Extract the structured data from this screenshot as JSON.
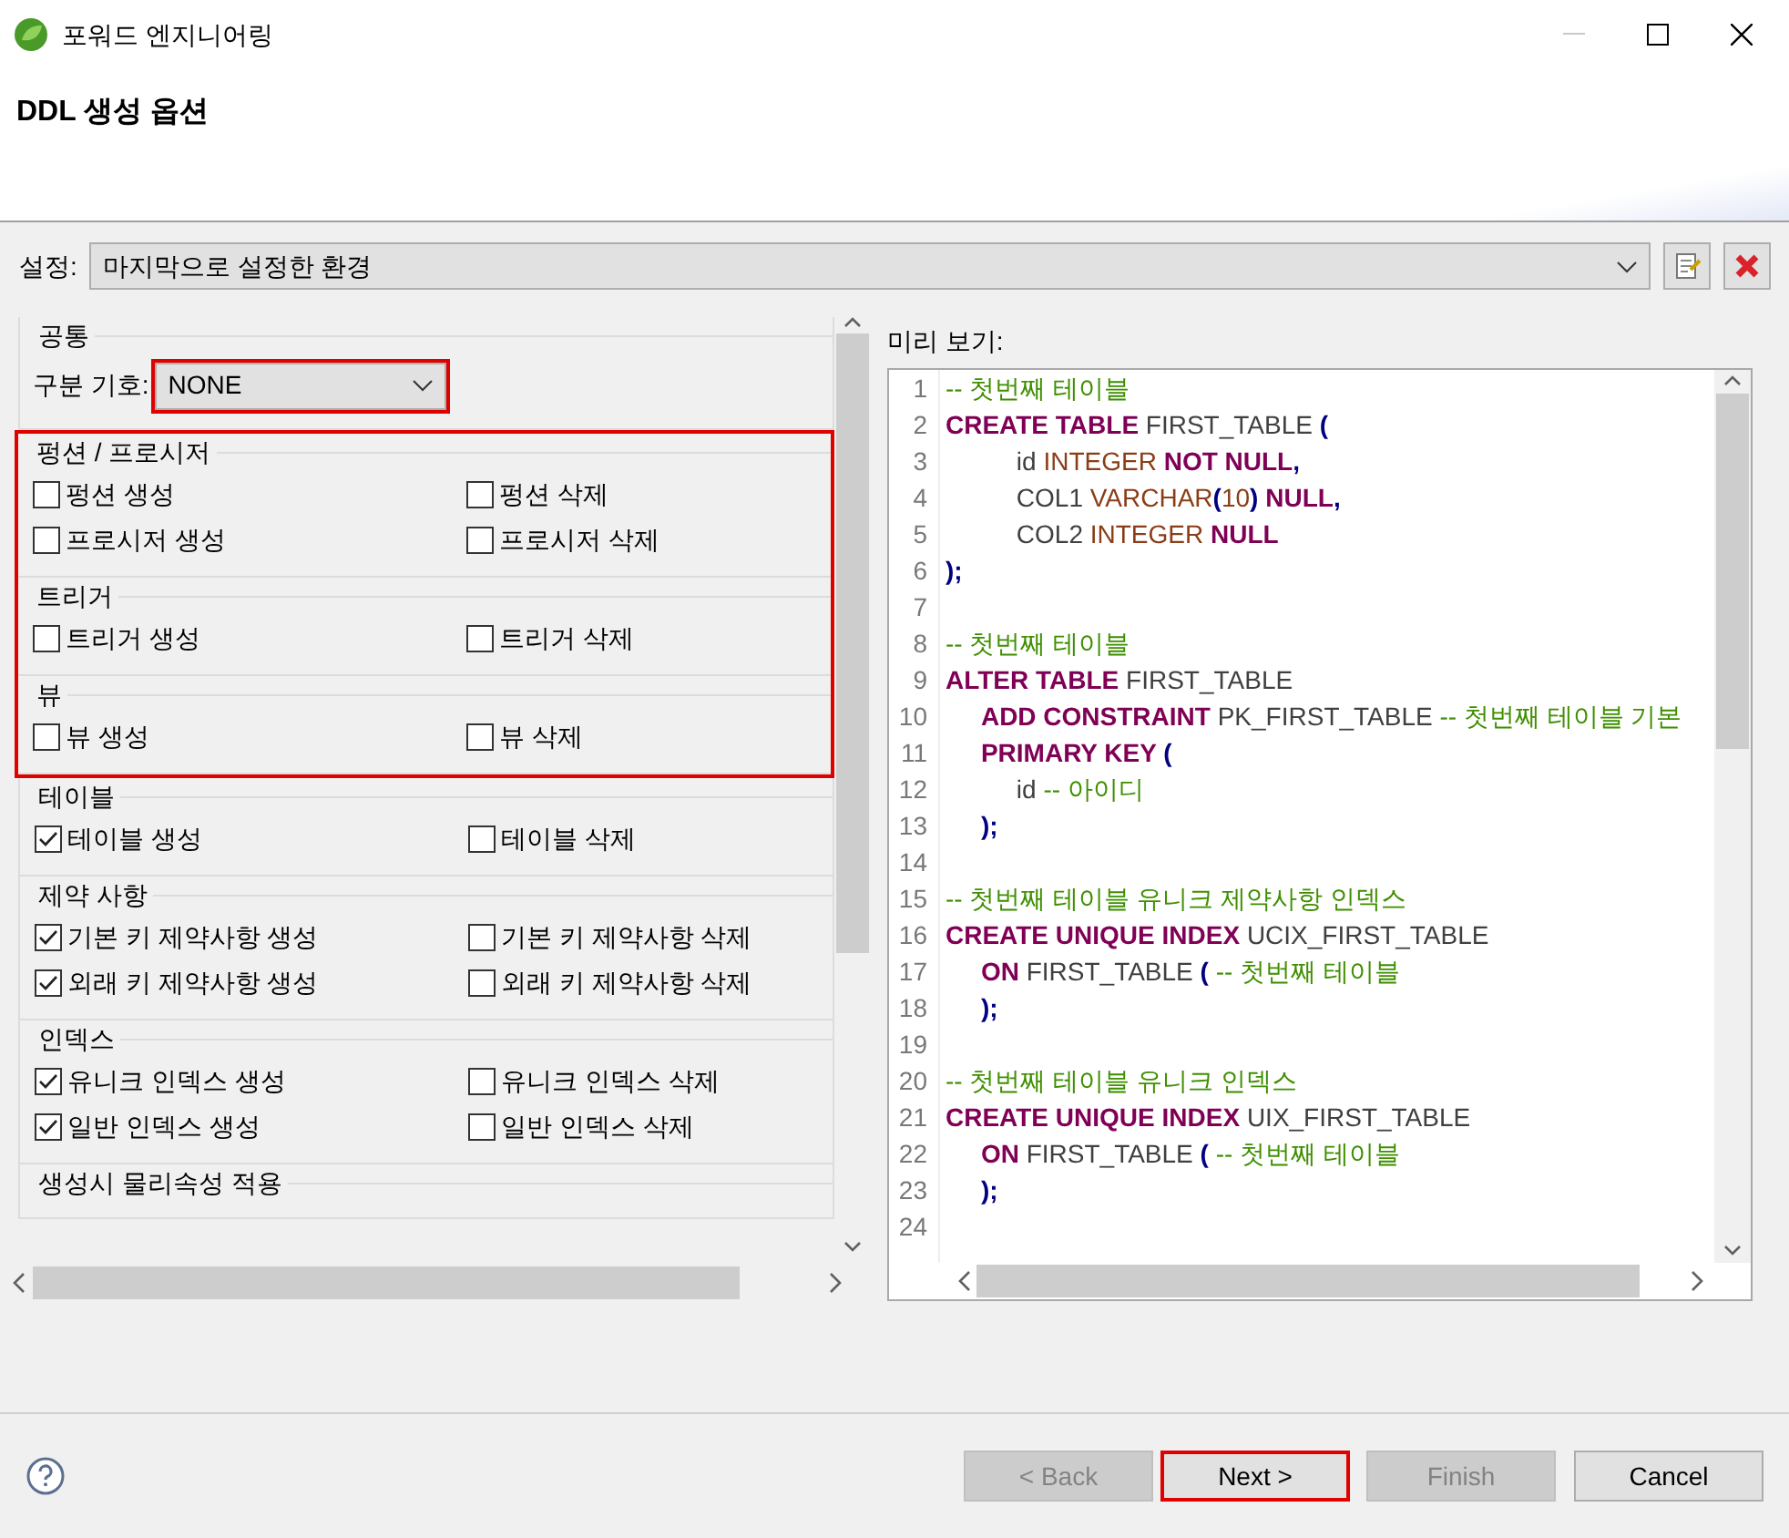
{
  "window": {
    "title": "포워드 엔지니어링"
  },
  "header": {
    "title": "DDL 생성 옵션"
  },
  "settings": {
    "label": "설정:",
    "value": "마지막으로 설정한 환경"
  },
  "options_panel": {
    "groups": [
      {
        "title": "공통",
        "highlighted": false,
        "separator": {
          "label": "구분 기호:",
          "value": "NONE",
          "highlighted": true
        }
      },
      {
        "title": "펑션 / 프로시저",
        "highlighted": true,
        "options": [
          {
            "label": "펑션 생성",
            "checked": false
          },
          {
            "label": "펑션 삭제",
            "checked": false
          },
          {
            "label": "프로시저 생성",
            "checked": false
          },
          {
            "label": "프로시저 삭제",
            "checked": false
          }
        ]
      },
      {
        "title": "트리거",
        "highlighted": true,
        "options": [
          {
            "label": "트리거 생성",
            "checked": false
          },
          {
            "label": "트리거 삭제",
            "checked": false
          }
        ]
      },
      {
        "title": "뷰",
        "highlighted": true,
        "options": [
          {
            "label": "뷰 생성",
            "checked": false
          },
          {
            "label": "뷰 삭제",
            "checked": false
          }
        ]
      },
      {
        "title": "테이블",
        "highlighted": false,
        "options": [
          {
            "label": "테이블 생성",
            "checked": true
          },
          {
            "label": "테이블 삭제",
            "checked": false
          }
        ]
      },
      {
        "title": "제약 사항",
        "highlighted": false,
        "options": [
          {
            "label": "기본 키 제약사항 생성",
            "checked": true
          },
          {
            "label": "기본 키 제약사항 삭제",
            "checked": false
          },
          {
            "label": "외래 키 제약사항 생성",
            "checked": true
          },
          {
            "label": "외래 키 제약사항 삭제",
            "checked": false
          }
        ]
      },
      {
        "title": "인덱스",
        "highlighted": false,
        "options": [
          {
            "label": "유니크 인덱스 생성",
            "checked": true
          },
          {
            "label": "유니크 인덱스 삭제",
            "checked": false
          },
          {
            "label": "일반 인덱스 생성",
            "checked": true
          },
          {
            "label": "일반 인덱스 삭제",
            "checked": false
          }
        ]
      },
      {
        "title": "생성시 물리속성 적용",
        "highlighted": false
      }
    ]
  },
  "preview": {
    "label": "미리 보기:",
    "lines": [
      {
        "number": "1",
        "tokens": [
          {
            "kind": "comment",
            "text": "-- 첫번째 테이블"
          }
        ]
      },
      {
        "number": "2",
        "tokens": [
          {
            "kind": "keyword",
            "text": "CREATE TABLE "
          },
          {
            "kind": "name",
            "text": "FIRST_TABLE "
          },
          {
            "kind": "punct",
            "text": "("
          }
        ]
      },
      {
        "number": "3",
        "tokens": [
          {
            "kind": "name",
            "text": "\t\tid "
          },
          {
            "kind": "type",
            "text": "INTEGER "
          },
          {
            "kind": "keyword",
            "text": "NOT NULL"
          },
          {
            "kind": "punct",
            "text": ","
          }
        ]
      },
      {
        "number": "4",
        "tokens": [
          {
            "kind": "name",
            "text": "\t\tCOL1 "
          },
          {
            "kind": "type",
            "text": "VARCHAR"
          },
          {
            "kind": "punct",
            "text": "("
          },
          {
            "kind": "type",
            "text": "10"
          },
          {
            "kind": "punct",
            "text": ") "
          },
          {
            "kind": "keyword",
            "text": "NULL"
          },
          {
            "kind": "punct",
            "text": ","
          }
        ]
      },
      {
        "number": "5",
        "tokens": [
          {
            "kind": "name",
            "text": "\t\tCOL2 "
          },
          {
            "kind": "type",
            "text": "INTEGER "
          },
          {
            "kind": "keyword",
            "text": "NULL"
          }
        ]
      },
      {
        "number": "6",
        "tokens": [
          {
            "kind": "punct",
            "text": ");"
          }
        ]
      },
      {
        "number": "7"
      },
      {
        "number": "8",
        "tokens": [
          {
            "kind": "comment",
            "text": "-- 첫번째 테이블"
          }
        ]
      },
      {
        "number": "9",
        "tokens": [
          {
            "kind": "keyword",
            "text": "ALTER TABLE "
          },
          {
            "kind": "name",
            "text": "FIRST_TABLE"
          }
        ]
      },
      {
        "number": "10",
        "tokens": [
          {
            "kind": "keyword",
            "text": "\tADD CONSTRAINT "
          },
          {
            "kind": "name",
            "text": "PK_FIRST_TABLE "
          },
          {
            "kind": "comment",
            "text": "-- 첫번째 테이블 기본"
          }
        ]
      },
      {
        "number": "11",
        "tokens": [
          {
            "kind": "keyword",
            "text": "\tPRIMARY KEY "
          },
          {
            "kind": "punct",
            "text": "("
          }
        ]
      },
      {
        "number": "12",
        "tokens": [
          {
            "kind": "name",
            "text": "\t\tid "
          },
          {
            "kind": "comment",
            "text": "-- 아이디"
          }
        ]
      },
      {
        "number": "13",
        "tokens": [
          {
            "kind": "punct",
            "text": "\t);"
          }
        ]
      },
      {
        "number": "14"
      },
      {
        "number": "15",
        "tokens": [
          {
            "kind": "comment",
            "text": "-- 첫번째 테이블 유니크 제약사항 인덱스"
          }
        ]
      },
      {
        "number": "16",
        "tokens": [
          {
            "kind": "keyword",
            "text": "CREATE UNIQUE INDEX "
          },
          {
            "kind": "name",
            "text": "UCIX_FIRST_TABLE"
          }
        ]
      },
      {
        "number": "17",
        "tokens": [
          {
            "kind": "keyword",
            "text": "\tON "
          },
          {
            "kind": "name",
            "text": "FIRST_TABLE "
          },
          {
            "kind": "punct",
            "text": "( "
          },
          {
            "kind": "comment",
            "text": "-- 첫번째 테이블"
          }
        ]
      },
      {
        "number": "18",
        "tokens": [
          {
            "kind": "punct",
            "text": "\t);"
          }
        ]
      },
      {
        "number": "19"
      },
      {
        "number": "20",
        "tokens": [
          {
            "kind": "comment",
            "text": "-- 첫번째 테이블 유니크 인덱스"
          }
        ]
      },
      {
        "number": "21",
        "tokens": [
          {
            "kind": "keyword",
            "text": "CREATE UNIQUE INDEX "
          },
          {
            "kind": "name",
            "text": "UIX_FIRST_TABLE"
          }
        ]
      },
      {
        "number": "22",
        "tokens": [
          {
            "kind": "keyword",
            "text": "\tON "
          },
          {
            "kind": "name",
            "text": "FIRST_TABLE "
          },
          {
            "kind": "punct",
            "text": "( "
          },
          {
            "kind": "comment",
            "text": "-- 첫번째 테이블"
          }
        ]
      },
      {
        "number": "23",
        "tokens": [
          {
            "kind": "punct",
            "text": "\t);"
          }
        ]
      },
      {
        "number": "24"
      }
    ]
  },
  "buttons": [
    {
      "label": "< Back",
      "disabled": true,
      "highlighted": false
    },
    {
      "label": "Next >",
      "disabled": false,
      "highlighted": true
    },
    {
      "label": "Finish",
      "disabled": true,
      "highlighted": false
    },
    {
      "label": "Cancel",
      "disabled": false,
      "highlighted": false
    }
  ]
}
